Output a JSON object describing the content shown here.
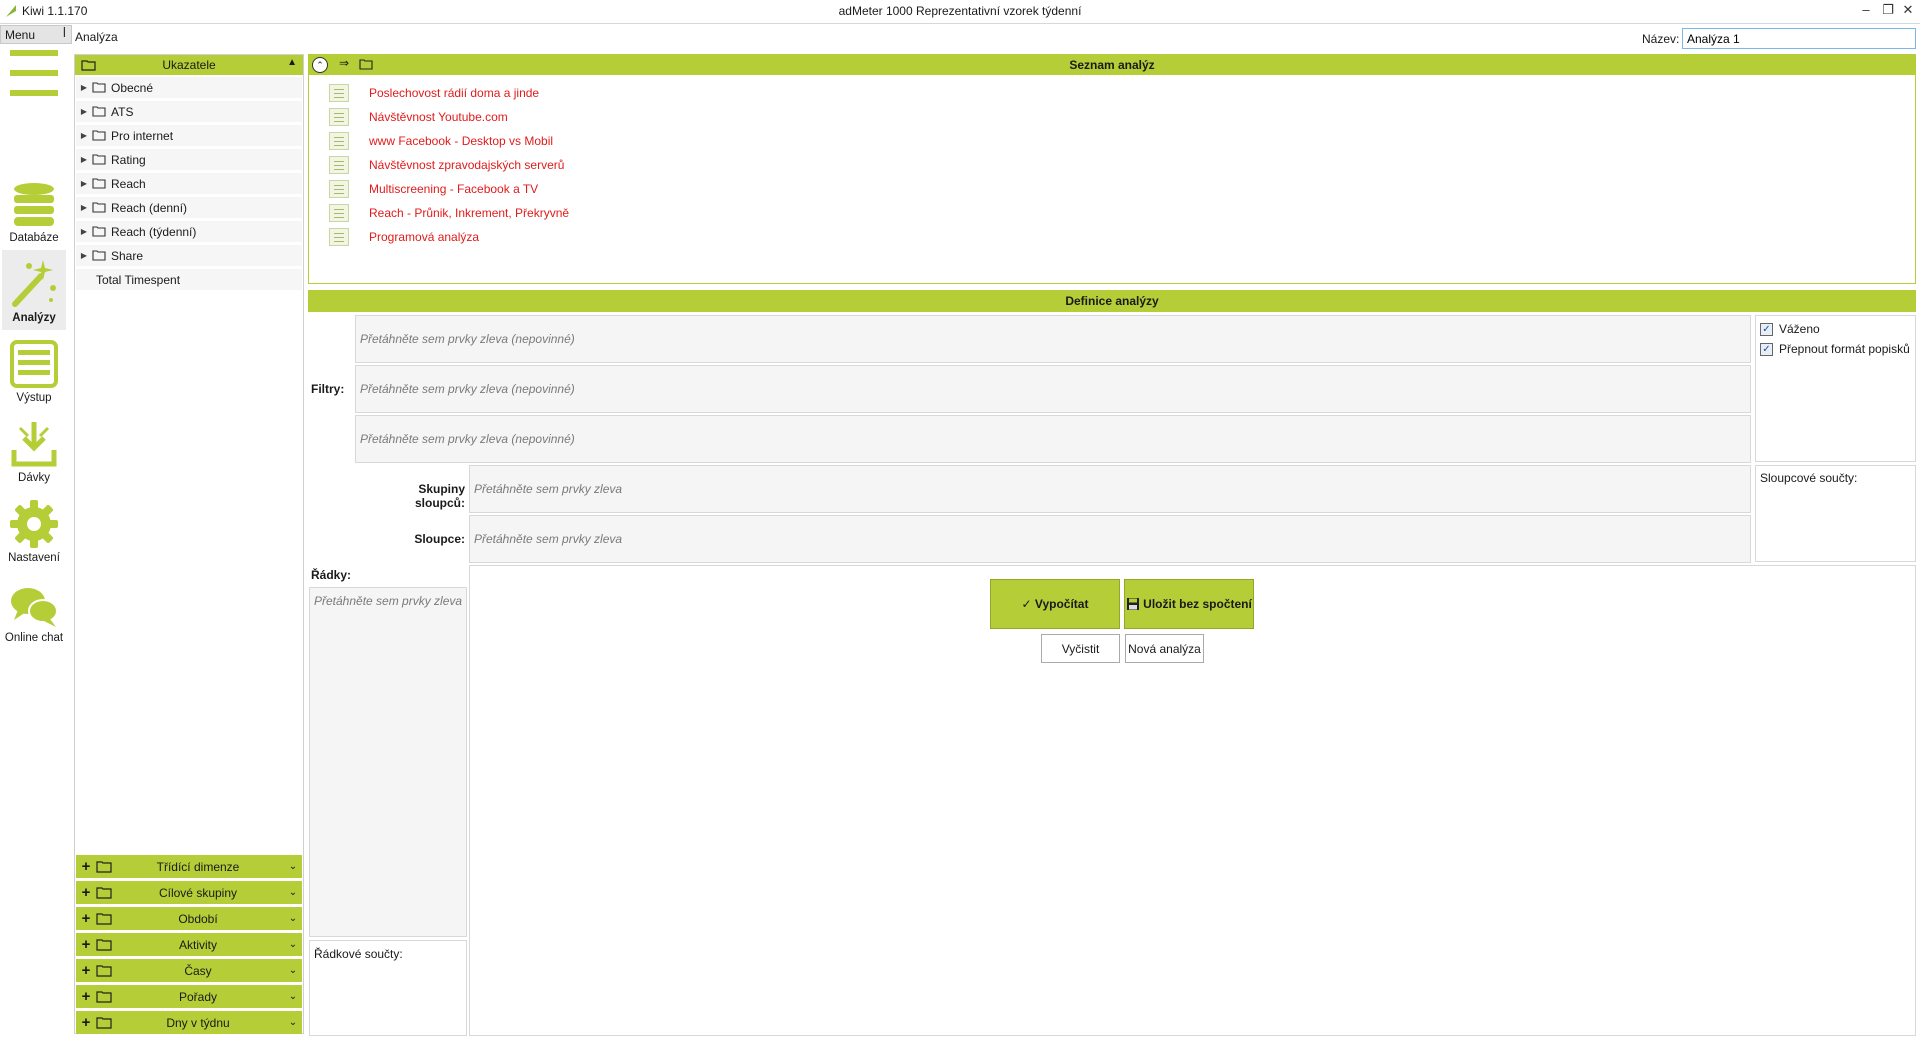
{
  "window": {
    "app_name": "Kiwi 1.1.170",
    "title": "adMeter 1000 Reprezentativní vzorek týdenní",
    "controls": [
      "minimize-icon",
      "restore-icon",
      "close-icon"
    ]
  },
  "menubar": {
    "menu_label": "Menu",
    "breadcrumb": "Analýza",
    "name_label": "Název:",
    "name_value": "Analýza 1"
  },
  "nav": {
    "items": [
      {
        "label": "Databáze",
        "icon": "database-icon"
      },
      {
        "label": "Analýzy",
        "icon": "magic-wand-icon",
        "active": true
      },
      {
        "label": "Výstup",
        "icon": "list-output-icon"
      },
      {
        "label": "Dávky",
        "icon": "batch-download-icon"
      },
      {
        "label": "Nastavení",
        "icon": "gear-icon"
      },
      {
        "label": "Online chat",
        "icon": "chat-bubbles-icon"
      }
    ]
  },
  "indicators": {
    "header": "Ukazatele",
    "tree": [
      {
        "label": "Obecné"
      },
      {
        "label": "ATS"
      },
      {
        "label": "Pro internet"
      },
      {
        "label": "Rating"
      },
      {
        "label": "Reach"
      },
      {
        "label": "Reach (denní)"
      },
      {
        "label": "Reach (týdenní)"
      },
      {
        "label": "Share"
      },
      {
        "label": "Total Timespent"
      }
    ],
    "dimensions": [
      "Třídící dimenze",
      "Cílové skupiny",
      "Období",
      "Aktivity",
      "Časy",
      "Pořady",
      "Dny v týdnu"
    ]
  },
  "analysis_list": {
    "header": "Seznam analýz",
    "items": [
      "Poslechovost rádií doma a jinde",
      "Návštěvnost Youtube.com",
      "www Facebook - Desktop vs Mobil",
      "Návštěvnost zpravodajských serverů",
      "Multiscreening - Facebook a TV",
      "Reach - Průnik, Inkrement, Překryvně",
      "Programová analýza"
    ]
  },
  "definition": {
    "header": "Definice analýzy",
    "filters_label": "Filtry:",
    "filter_placeholder": "Přetáhněte sem prvky zleva (nepovinné)",
    "column_groups_label": "Skupiny sloupců:",
    "columns_label": "Sloupce:",
    "drop_placeholder": "Přetáhněte sem prvky zleva",
    "rows_label": "Řádky:",
    "row_totals_label": "Řádkové součty:",
    "column_totals_label": "Sloupcové součty:",
    "weighted_label": "Váženo",
    "weighted_checked": true,
    "switch_format_label": "Přepnout formát popisků",
    "switch_format_checked": true,
    "calculate_label": "✓ Vypočítat",
    "save_label": "Uložit bez spočtení",
    "clear_label": "Vyčistit",
    "new_label": "Nová analýza"
  },
  "colors": {
    "accent": "#b5cd36",
    "list_text": "#e01b1b"
  }
}
